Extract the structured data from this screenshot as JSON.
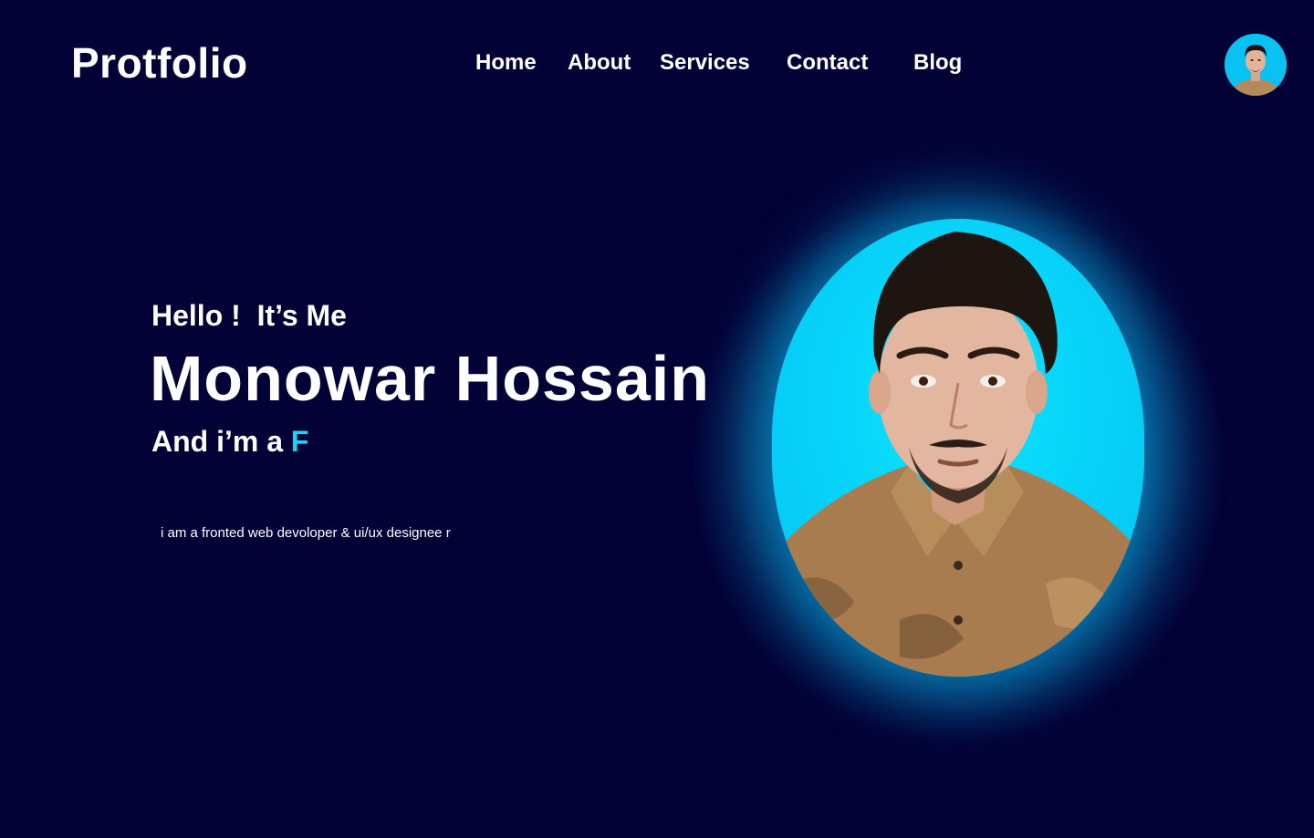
{
  "header": {
    "logo": "Protfolio",
    "nav": [
      {
        "label": "Home"
      },
      {
        "label": "About"
      },
      {
        "label": "Services"
      },
      {
        "label": "Contact"
      },
      {
        "label": "Blog"
      }
    ],
    "avatar": "profile-avatar"
  },
  "hero": {
    "greeting": "Hello !  It’s Me",
    "name": "Monowar Hossain",
    "role_prefix": "And i’m a ",
    "role_typed": "F",
    "description": "i am a fronted web devoloper & ui/ux designee r"
  },
  "colors": {
    "background": "#030236",
    "accent": "#16d6f5",
    "text": "#ffffff"
  }
}
